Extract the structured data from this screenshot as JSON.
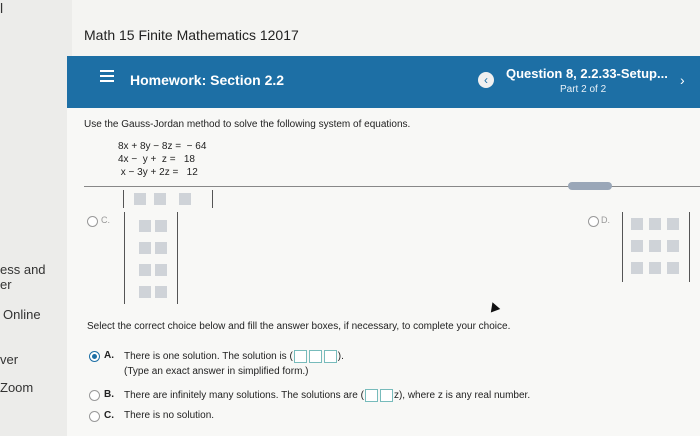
{
  "course": {
    "title": "Math 15 Finite Mathematics 12017"
  },
  "sidebar": {
    "items": [
      "ess and",
      "er",
      "Online",
      "ver",
      "Zoom"
    ]
  },
  "header": {
    "homework_label": "Homework: Section 2.2",
    "question_title": "Question 8, 2.2.33-Setup...",
    "part": "Part 2 of 2",
    "prev_symbol": "‹",
    "next_symbol": "›"
  },
  "problem": {
    "instruction": "Use the Gauss-Jordan method to solve the following system of equations.",
    "equations": [
      "8x + 8y − 8z =  − 64",
      "4x −  y +  z =   18",
      " x − 3y + 2z =   12"
    ],
    "more_label": "•••••"
  },
  "matrix_options": {
    "c_label": "C.",
    "d_label": "D."
  },
  "question": {
    "prompt": "Select the correct choice below and fill the answer boxes, if necessary, to complete your choice.",
    "choices": [
      {
        "letter": "A.",
        "text_before": "There is one solution. The solution is (",
        "text_after": ").",
        "note": "(Type an exact answer in simplified form.)"
      },
      {
        "letter": "B.",
        "text_before": "There are infinitely many solutions. The solutions are (",
        "text_after": "z), where z is any real number."
      },
      {
        "letter": "C.",
        "text": "There is no solution."
      }
    ]
  },
  "colors": {
    "accent": "#1d6fa5"
  }
}
